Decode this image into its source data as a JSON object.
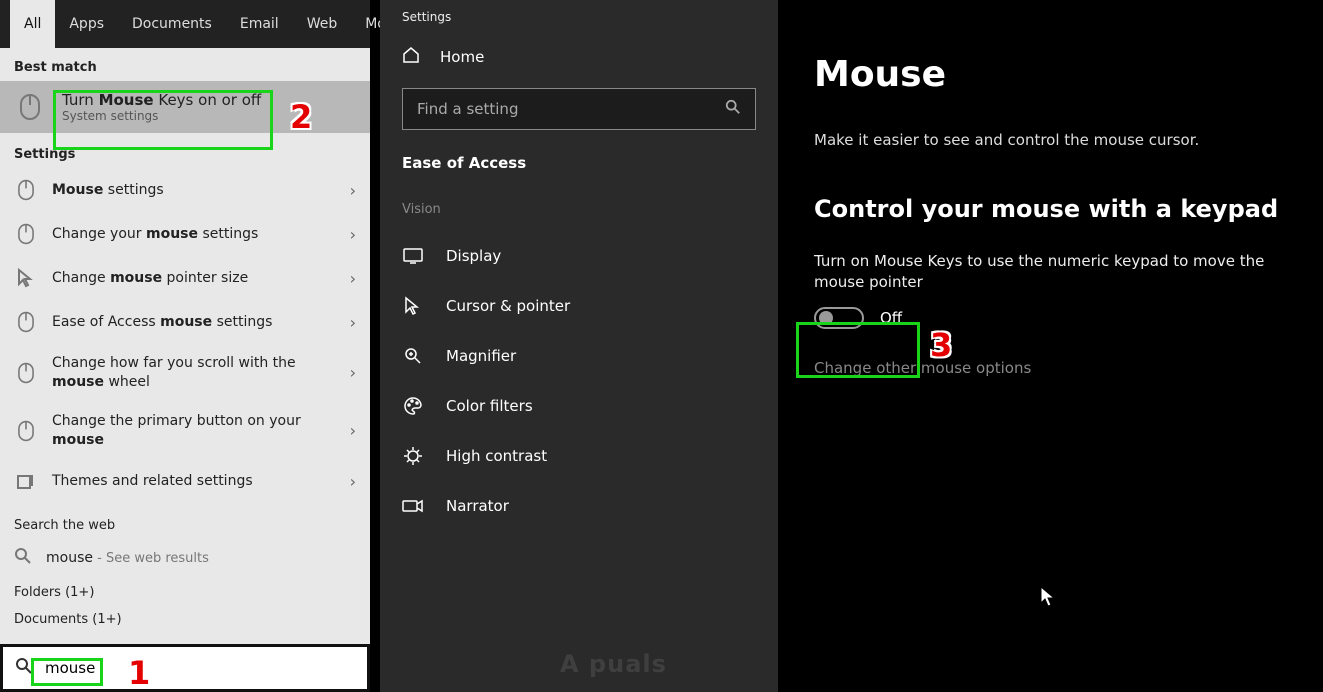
{
  "search": {
    "tabs": [
      "All",
      "Apps",
      "Documents",
      "Email",
      "Web",
      "Mo"
    ],
    "best_match_header": "Best match",
    "best_match": {
      "title_pre": "Turn ",
      "title_bold": "Mouse",
      "title_post": " Keys on or off",
      "subtitle": "System settings"
    },
    "settings_header": "Settings",
    "results": [
      {
        "icon": "mouse",
        "pre": "",
        "bold": "Mouse",
        "post": " settings"
      },
      {
        "icon": "mouse",
        "pre": "Change your ",
        "bold": "mouse",
        "post": " settings"
      },
      {
        "icon": "pointer",
        "pre": "Change ",
        "bold": "mouse",
        "post": " pointer size"
      },
      {
        "icon": "mouse",
        "pre": "Ease of Access ",
        "bold": "mouse",
        "post": " settings"
      },
      {
        "icon": "mouse",
        "pre": "Change how far you scroll with the ",
        "bold": "mouse",
        "post": " wheel"
      },
      {
        "icon": "mouse",
        "pre": "Change the primary button on your ",
        "bold": "mouse",
        "post": ""
      },
      {
        "icon": "themes",
        "pre": "Themes and related settings",
        "bold": "",
        "post": ""
      }
    ],
    "web_header": "Search the web",
    "web_term": "mouse",
    "web_sub": " - See web results",
    "folders_label": "Folders (1+)",
    "documents_label": "Documents (1+)",
    "input_value": "mouse"
  },
  "sidebar": {
    "title": "Settings",
    "home": "Home",
    "find_placeholder": "Find a setting",
    "ease": "Ease of Access",
    "group": "Vision",
    "items": [
      {
        "label": "Display",
        "icon": "display"
      },
      {
        "label": "Cursor & pointer",
        "icon": "cursor"
      },
      {
        "label": "Magnifier",
        "icon": "magnifier"
      },
      {
        "label": "Color filters",
        "icon": "palette"
      },
      {
        "label": "High contrast",
        "icon": "contrast"
      },
      {
        "label": "Narrator",
        "icon": "narrator"
      }
    ]
  },
  "page": {
    "heading": "Mouse",
    "subtitle": "Make it easier to see and control the mouse cursor.",
    "section_heading": "Control your mouse with a keypad",
    "desc": "Turn on Mouse Keys to use the numeric keypad to move the mouse pointer",
    "toggle_state": "Off",
    "link": "Change other mouse options"
  },
  "callouts": {
    "c1": "1",
    "c2": "2",
    "c3": "3"
  },
  "watermark": "A  puals"
}
